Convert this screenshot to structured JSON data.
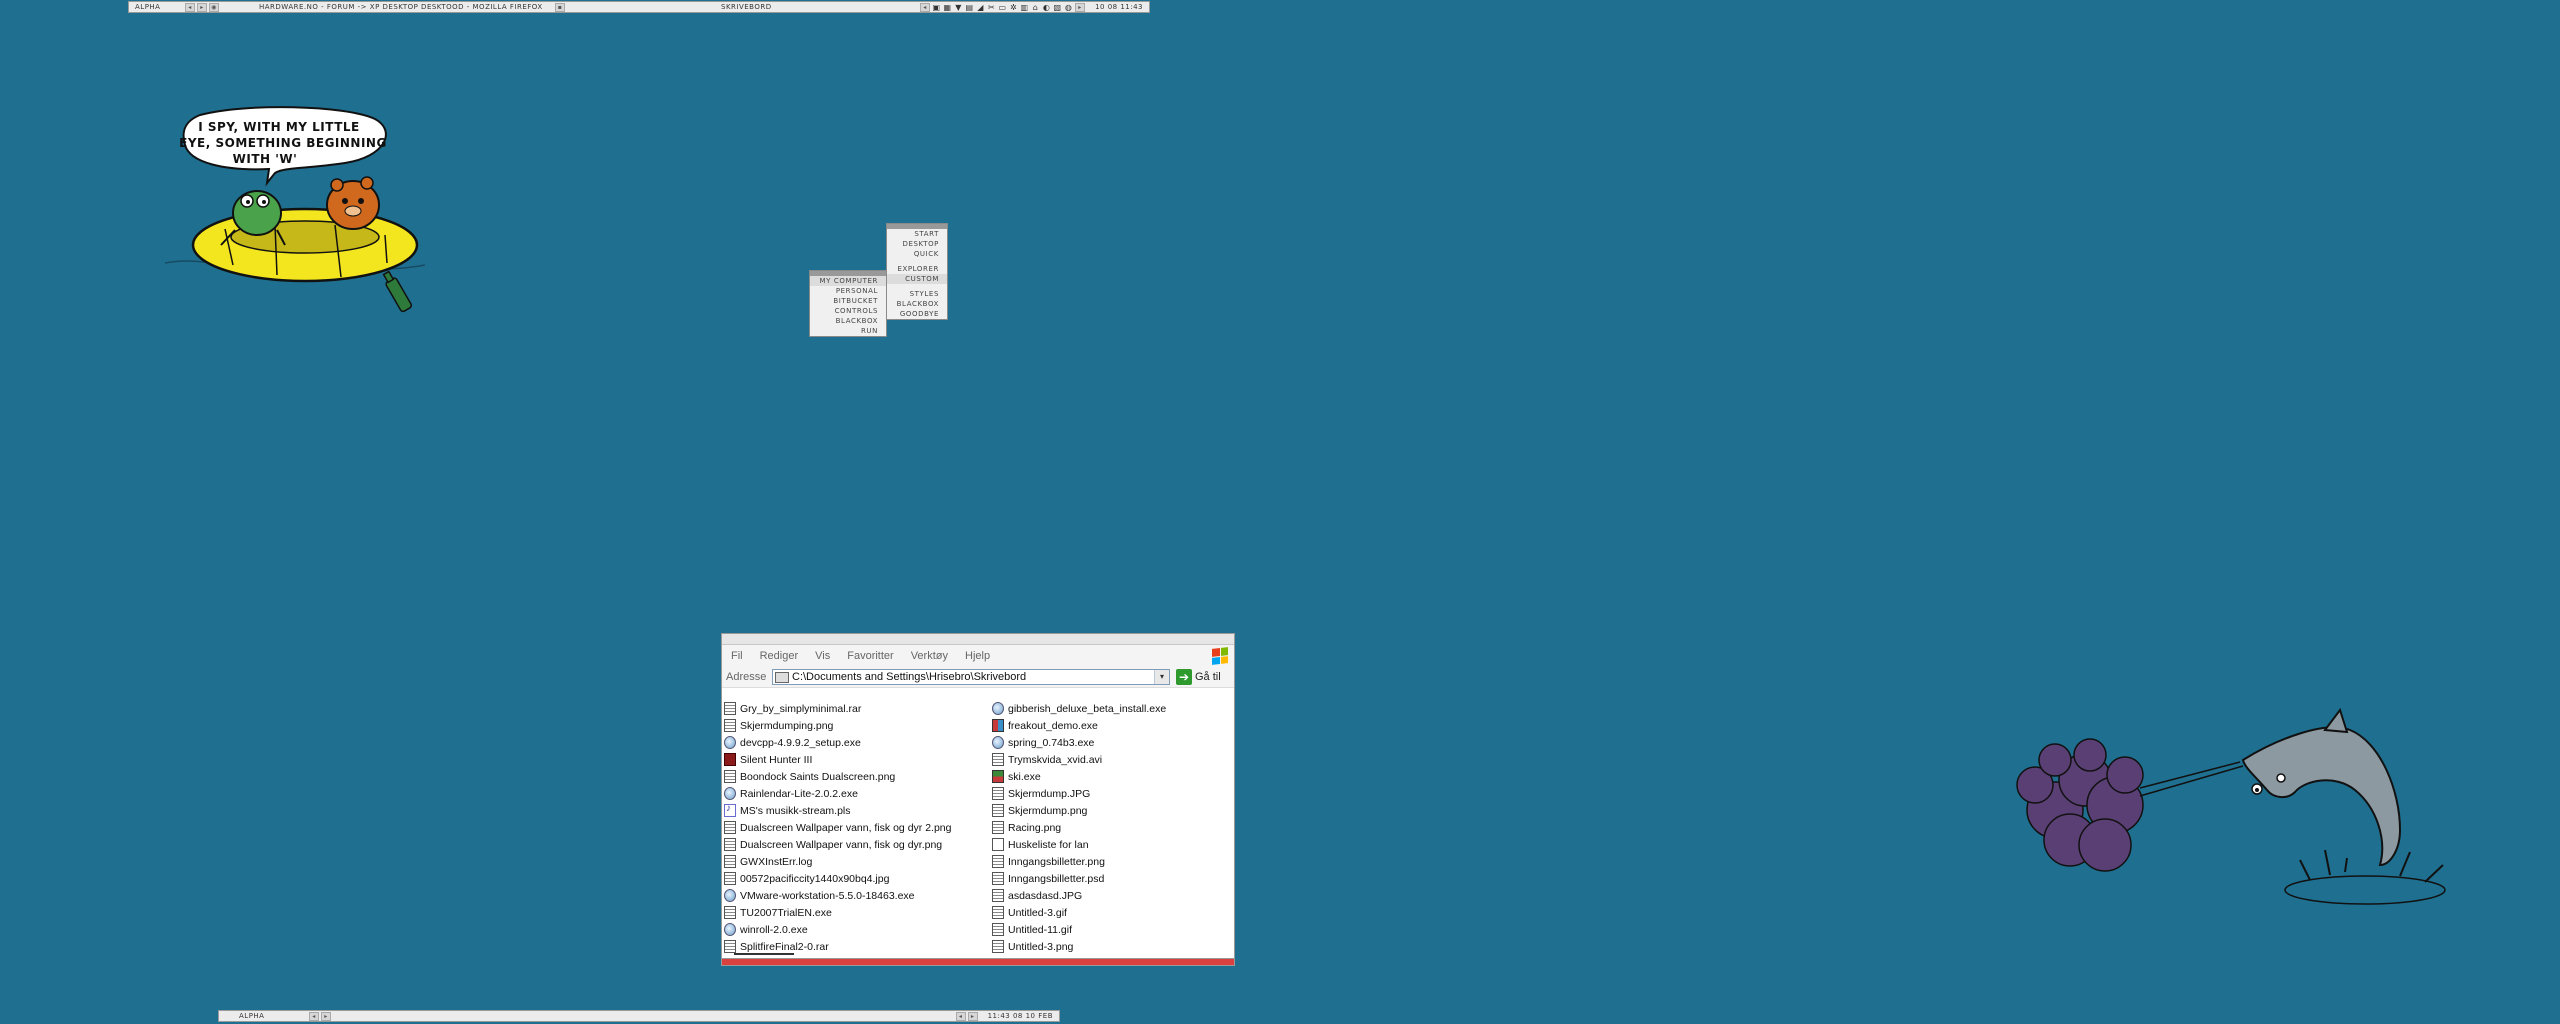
{
  "top_toolbar": {
    "workspace": "ALPHA",
    "window_title": "HARDWARE.NO - FORUM -> XP DESKTOP DESKTOOD - MOZILLA FIREFOX",
    "center_label": "SKRIVEBORD",
    "clock": "10 08 11:43"
  },
  "bottom_toolbar": {
    "workspace": "ALPHA",
    "clock": "11:43 08 10 FEB"
  },
  "menu_main": {
    "items": [
      "START",
      "DESKTOP",
      "QUICK",
      "EXPLORER",
      "CUSTOM",
      "STYLES",
      "BLACKBOX",
      "GOODBYE"
    ]
  },
  "menu_sub": {
    "items": [
      "MY COMPUTER",
      "PERSONAL",
      "BITBUCKET",
      "CONTROLS",
      "BLACKBOX",
      "RUN"
    ]
  },
  "explorer": {
    "menu": [
      "Fil",
      "Rediger",
      "Vis",
      "Favoritter",
      "Verktøy",
      "Hjelp"
    ],
    "address_label": "Adresse",
    "address_value": "C:\\Documents and Settings\\Hrisebro\\Skrivebord",
    "go_label": "Gå til",
    "files_left": [
      {
        "name": "Gry_by_simplyminimal.rar",
        "icon": "generic"
      },
      {
        "name": "Skjermdumping.png",
        "icon": "generic"
      },
      {
        "name": "devcpp-4.9.9.2_setup.exe",
        "icon": "exe"
      },
      {
        "name": "Silent Hunter III",
        "icon": "game"
      },
      {
        "name": "Boondock Saints Dualscreen.png",
        "icon": "generic"
      },
      {
        "name": "Rainlendar-Lite-2.0.2.exe",
        "icon": "exe"
      },
      {
        "name": "MS's musikk-stream.pls",
        "icon": "media"
      },
      {
        "name": "Dualscreen Wallpaper vann, fisk og dyr 2.png",
        "icon": "generic"
      },
      {
        "name": "Dualscreen Wallpaper vann, fisk og dyr.png",
        "icon": "generic"
      },
      {
        "name": "GWXInstErr.log",
        "icon": "generic"
      },
      {
        "name": "00572pacificcity1440x90bq4.jpg",
        "icon": "generic"
      },
      {
        "name": "VMware-workstation-5.5.0-18463.exe",
        "icon": "exe"
      },
      {
        "name": "TU2007TrialEN.exe",
        "icon": "generic"
      },
      {
        "name": "winroll-2.0.exe",
        "icon": "exe"
      },
      {
        "name": "SplitfireFinal2-0.rar",
        "icon": "generic"
      }
    ],
    "files_right": [
      {
        "name": "gibberish_deluxe_beta_install.exe",
        "icon": "exe"
      },
      {
        "name": "freakout_demo.exe",
        "icon": "dual"
      },
      {
        "name": "spring_0.74b3.exe",
        "icon": "exe"
      },
      {
        "name": "Trymskvida_xvid.avi",
        "icon": "generic"
      },
      {
        "name": "ski.exe",
        "icon": "ski"
      },
      {
        "name": "Skjermdump.JPG",
        "icon": "generic"
      },
      {
        "name": "Skjermdump.png",
        "icon": "generic"
      },
      {
        "name": "Racing.png",
        "icon": "generic"
      },
      {
        "name": "Huskeliste for lan",
        "icon": "text"
      },
      {
        "name": "Inngangsbilletter.png",
        "icon": "generic"
      },
      {
        "name": "Inngangsbilletter.psd",
        "icon": "generic"
      },
      {
        "name": "asdasdasd.JPG",
        "icon": "generic"
      },
      {
        "name": "Untitled-3.gif",
        "icon": "generic"
      },
      {
        "name": "Untitled-11.gif",
        "icon": "generic"
      },
      {
        "name": "Untitled-3.png",
        "icon": "generic"
      }
    ]
  },
  "speech_bubble": {
    "line1": "I SPY, WITH MY LITTLE",
    "line2": "EYE, SOMETHING BEGINNING",
    "line3": "WITH 'W'"
  },
  "colors": {
    "desktop": "#1f7090",
    "raft": "#f4e61e",
    "cloud": "#5a3f74",
    "dolphin": "#8d99a1"
  }
}
